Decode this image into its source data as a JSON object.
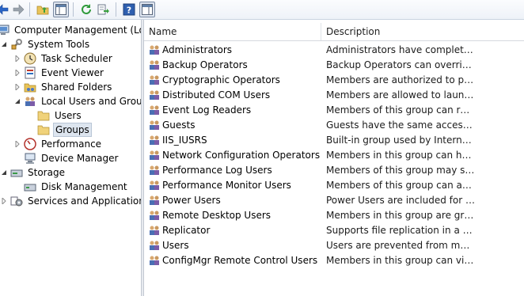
{
  "tree": {
    "root": "Computer Management (Local",
    "system_tools": "System Tools",
    "task_scheduler": "Task Scheduler",
    "event_viewer": "Event Viewer",
    "shared_folders": "Shared Folders",
    "local_users_groups": "Local Users and Groups",
    "users": "Users",
    "groups": "Groups",
    "performance": "Performance",
    "device_manager": "Device Manager",
    "storage": "Storage",
    "disk_management": "Disk Management",
    "services_apps": "Services and Applications"
  },
  "list": {
    "columns": {
      "name": "Name",
      "description": "Description"
    },
    "rows": [
      {
        "name": "Administrators",
        "description": "Administrators have complete an..."
      },
      {
        "name": "Backup Operators",
        "description": "Backup Operators can override se..."
      },
      {
        "name": "Cryptographic Operators",
        "description": "Members are authorized to perfo..."
      },
      {
        "name": "Distributed COM Users",
        "description": "Members are allowed to launch, a..."
      },
      {
        "name": "Event Log Readers",
        "description": "Members of this group can read e..."
      },
      {
        "name": "Guests",
        "description": "Guests have the same access as m..."
      },
      {
        "name": "IIS_IUSRS",
        "description": "Built-in group used by Internet Inf..."
      },
      {
        "name": "Network Configuration Operators",
        "description": "Members in this group can have s..."
      },
      {
        "name": "Performance Log Users",
        "description": "Members of this group may sche..."
      },
      {
        "name": "Performance Monitor Users",
        "description": "Members of this group can acces..."
      },
      {
        "name": "Power Users",
        "description": "Power Users are included for back..."
      },
      {
        "name": "Remote Desktop Users",
        "description": "Members in this group are grante..."
      },
      {
        "name": "Replicator",
        "description": "Supports file replication in a dom..."
      },
      {
        "name": "Users",
        "description": "Users are prevented from making ..."
      },
      {
        "name": "ConfigMgr Remote Control Users",
        "description": "Members in this group can view a..."
      }
    ]
  },
  "icons": {
    "toolbar": [
      "back-arrow-icon",
      "forward-arrow-icon",
      "up-folder-icon",
      "show-hide-console-tree-icon",
      "refresh-icon",
      "export-list-icon",
      "help-icon",
      "show-hide-action-pane-icon"
    ],
    "group": "user-group-icon"
  },
  "colors": {
    "selection": "#dde5ef",
    "toolbar_arrow": "#2a64c6"
  }
}
